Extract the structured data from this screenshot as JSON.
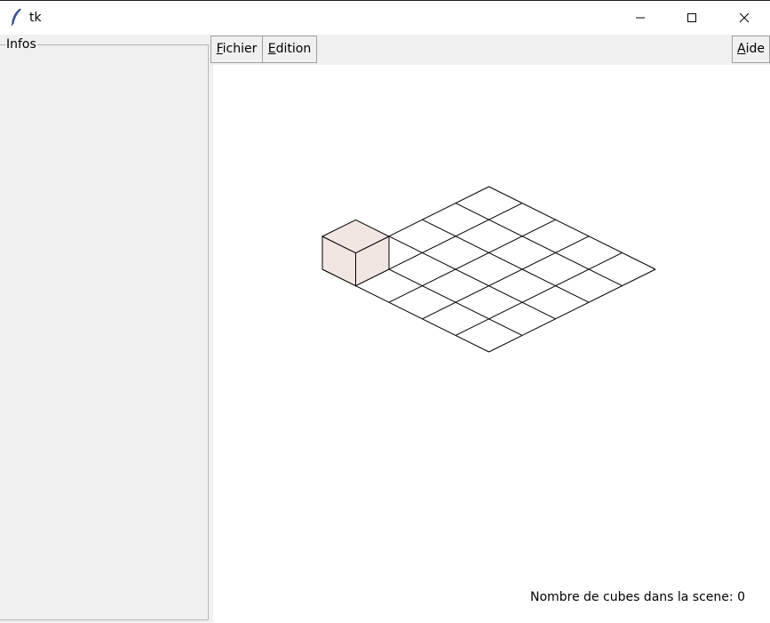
{
  "window": {
    "title": "tk",
    "app_icon": "feather-icon",
    "controls": [
      "minimize-icon",
      "maximize-icon",
      "close-icon"
    ]
  },
  "left_panel": {
    "frame_label": "Infos"
  },
  "menubar": {
    "items": [
      {
        "label_underlined": "F",
        "label_rest": "ichier"
      },
      {
        "label_underlined": "E",
        "label_rest": "dition"
      }
    ],
    "help": {
      "label_underlined": "A",
      "label_rest": "ide"
    }
  },
  "scene": {
    "grid_size": 5,
    "cube_count_label": "Nombre de cubes dans la scene:",
    "cube_count": "0",
    "cube_face_color": "#f2e6e3",
    "line_color": "#000000"
  }
}
